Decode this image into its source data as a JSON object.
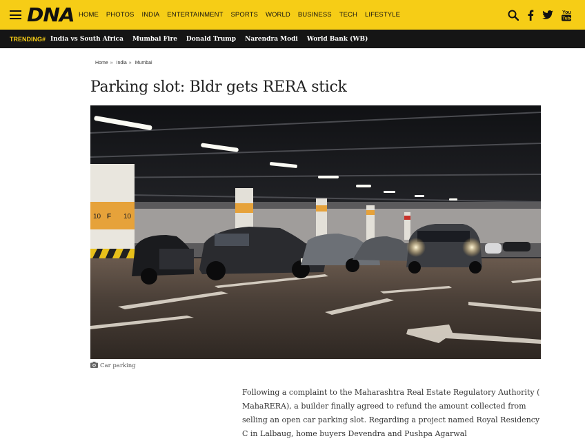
{
  "site": {
    "logo": "DNA"
  },
  "nav": {
    "items": [
      "HOME",
      "PHOTOS",
      "INDIA",
      "ENTERTAINMENT",
      "SPORTS",
      "WORLD",
      "BUSINESS",
      "TECH",
      "LIFESTYLE"
    ]
  },
  "icons": [
    "search-icon",
    "facebook-icon",
    "twitter-icon",
    "youtube-icon"
  ],
  "trending": {
    "label": "TRENDING#",
    "items": [
      "India vs South Africa",
      "Mumbai Fire",
      "Donald Trump",
      "Narendra Modi",
      "World Bank (WB)"
    ]
  },
  "breadcrumb": {
    "items": [
      "Home",
      "India",
      "Mumbai"
    ],
    "separator": "»"
  },
  "article": {
    "title": "Parking slot: Bldr gets RERA stick",
    "image_caption": "Car parking",
    "body": "Following a complaint to the Maharashtra Real Estate Regulatory Authority ( MahaRERA), a builder finally agreed to refund the amount collected from selling an open car parking slot. Regarding a project named Royal Residency C in Lalbaug, home buyers Devendra and Pushpa Agarwal"
  },
  "colors": {
    "brand_yellow": "#f6cd16",
    "trending_bg": "#151515"
  }
}
